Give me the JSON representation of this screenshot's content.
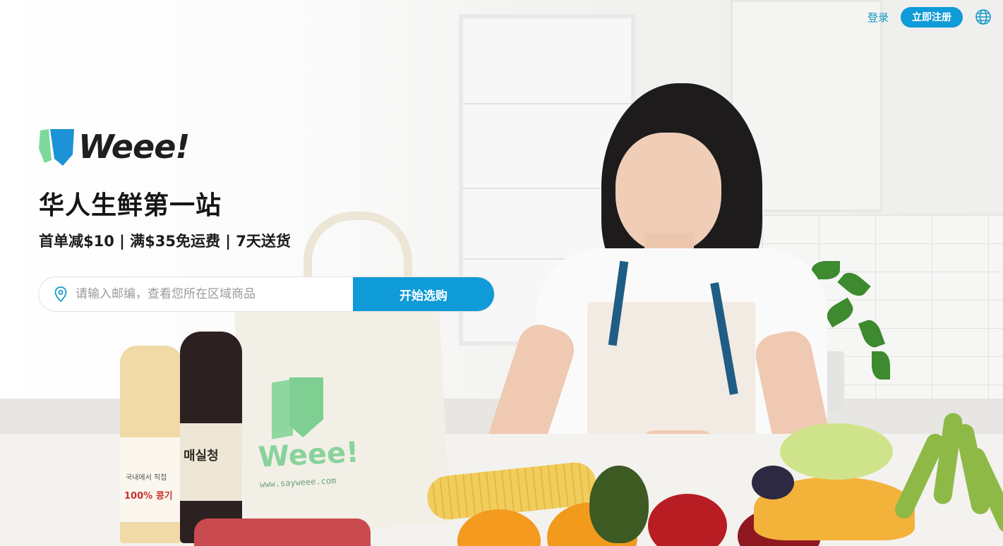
{
  "header": {
    "login_label": "登录",
    "signup_label": "立即注册",
    "language_icon": "globe-icon"
  },
  "hero": {
    "logo_text": "Weee!",
    "headline": "华人生鲜第一站",
    "subline": "首单减$10 | 满$35免运费 | 7天送货"
  },
  "search": {
    "icon": "location-pin-icon",
    "placeholder": "请输入邮编，查看您所在区域商品",
    "value": "",
    "button_label": "开始选购"
  },
  "photo": {
    "bag_brand": "Weee!",
    "bag_url": "www.sayweee.com",
    "bottle_label": "매실청",
    "bottle2_label": "100% 콩기",
    "bottle2_small": "국내에서 직접"
  },
  "colors": {
    "accent": "#0f9ad8",
    "logo_green": "#7ed89a",
    "logo_blue": "#1c93d6",
    "text_dark": "#151515"
  }
}
